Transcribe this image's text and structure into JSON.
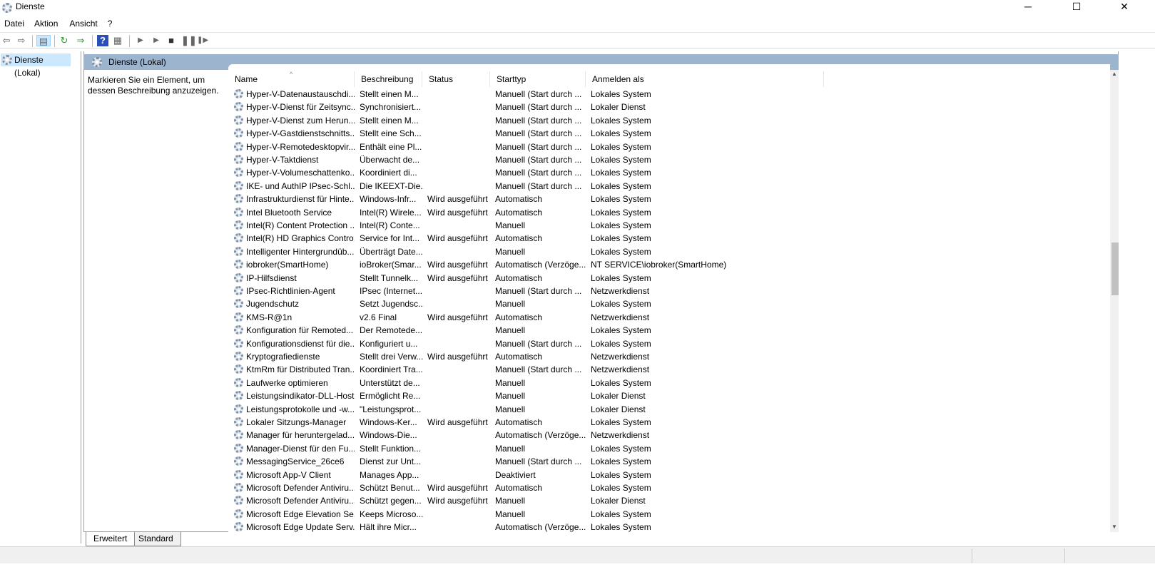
{
  "window": {
    "title": "Dienste",
    "minimize": "─",
    "maximize": "☐",
    "close": "✕"
  },
  "menu": [
    "Datei",
    "Aktion",
    "Ansicht",
    "?"
  ],
  "toolbar": {
    "icons": [
      "back-icon",
      "forward-icon",
      "show-hide-console-tree-icon",
      "refresh-icon",
      "export-list-icon",
      "help-icon",
      "properties-icon",
      "start-icon",
      "start-alt-icon",
      "stop-icon",
      "pause-icon",
      "restart-icon"
    ]
  },
  "tree": {
    "item": "Dienste (Lokal)"
  },
  "main": {
    "header": "Dienste (Lokal)",
    "description": "Markieren Sie ein Element, um dessen Beschreibung anzuzeigen.",
    "columns": [
      "Name",
      "Beschreibung",
      "Status",
      "Starttyp",
      "Anmelden als"
    ],
    "rows": [
      [
        "Hyper-V-Datenaustauschdi...",
        "Stellt einen M...",
        "",
        "Manuell (Start durch ...",
        "Lokales System"
      ],
      [
        "Hyper-V-Dienst für Zeitsync...",
        "Synchronisiert...",
        "",
        "Manuell (Start durch ...",
        "Lokaler Dienst"
      ],
      [
        "Hyper-V-Dienst zum Herun...",
        "Stellt einen M...",
        "",
        "Manuell (Start durch ...",
        "Lokales System"
      ],
      [
        "Hyper-V-Gastdienstschnitts...",
        "Stellt eine Sch...",
        "",
        "Manuell (Start durch ...",
        "Lokales System"
      ],
      [
        "Hyper-V-Remotedesktopvir...",
        "Enthält eine Pl...",
        "",
        "Manuell (Start durch ...",
        "Lokales System"
      ],
      [
        "Hyper-V-Taktdienst",
        "Überwacht de...",
        "",
        "Manuell (Start durch ...",
        "Lokales System"
      ],
      [
        "Hyper-V-Volumeschattenko...",
        "Koordiniert di...",
        "",
        "Manuell (Start durch ...",
        "Lokales System"
      ],
      [
        "IKE- und AuthIP IPsec-Schl...",
        "Die IKEEXT-Die...",
        "",
        "Manuell (Start durch ...",
        "Lokales System"
      ],
      [
        "Infrastrukturdienst für Hinte...",
        "Windows-Infr...",
        "Wird ausgeführt",
        "Automatisch",
        "Lokales System"
      ],
      [
        "Intel Bluetooth Service",
        "Intel(R) Wirele...",
        "Wird ausgeführt",
        "Automatisch",
        "Lokales System"
      ],
      [
        "Intel(R) Content Protection ...",
        "Intel(R) Conte...",
        "",
        "Manuell",
        "Lokales System"
      ],
      [
        "Intel(R) HD Graphics Contro...",
        "Service for Int...",
        "Wird ausgeführt",
        "Automatisch",
        "Lokales System"
      ],
      [
        "Intelligenter Hintergrundüb...",
        "Überträgt Date...",
        "",
        "Manuell",
        "Lokales System"
      ],
      [
        "iobroker(SmartHome)",
        "ioBroker(Smar...",
        "Wird ausgeführt",
        "Automatisch (Verzöge...",
        "NT SERVICE\\iobroker(SmartHome)"
      ],
      [
        "IP-Hilfsdienst",
        "Stellt Tunnelk...",
        "Wird ausgeführt",
        "Automatisch",
        "Lokales System"
      ],
      [
        "IPsec-Richtlinien-Agent",
        "IPsec (Internet...",
        "",
        "Manuell (Start durch ...",
        "Netzwerkdienst"
      ],
      [
        "Jugendschutz",
        "Setzt Jugendsc...",
        "",
        "Manuell",
        "Lokales System"
      ],
      [
        "KMS-R@1n",
        "v2.6 Final",
        "Wird ausgeführt",
        "Automatisch",
        "Netzwerkdienst"
      ],
      [
        "Konfiguration für Remoted...",
        "Der Remotede...",
        "",
        "Manuell",
        "Lokales System"
      ],
      [
        "Konfigurationsdienst für die...",
        "Konfiguriert u...",
        "",
        "Manuell (Start durch ...",
        "Lokales System"
      ],
      [
        "Kryptografiedienste",
        "Stellt drei Verw...",
        "Wird ausgeführt",
        "Automatisch",
        "Netzwerkdienst"
      ],
      [
        "KtmRm für Distributed Tran...",
        "Koordiniert Tra...",
        "",
        "Manuell (Start durch ...",
        "Netzwerkdienst"
      ],
      [
        "Laufwerke optimieren",
        "Unterstützt de...",
        "",
        "Manuell",
        "Lokales System"
      ],
      [
        "Leistungsindikator-DLL-Host",
        "Ermöglicht Re...",
        "",
        "Manuell",
        "Lokaler Dienst"
      ],
      [
        "Leistungsprotokolle und -w...",
        "\"Leistungsprot...",
        "",
        "Manuell",
        "Lokaler Dienst"
      ],
      [
        "Lokaler Sitzungs-Manager",
        "Windows-Ker...",
        "Wird ausgeführt",
        "Automatisch",
        "Lokales System"
      ],
      [
        "Manager für heruntergelad...",
        "Windows-Die...",
        "",
        "Automatisch (Verzöge...",
        "Netzwerkdienst"
      ],
      [
        "Manager-Dienst für den Fu...",
        "Stellt Funktion...",
        "",
        "Manuell",
        "Lokales System"
      ],
      [
        "MessagingService_26ce6",
        "Dienst zur Unt...",
        "",
        "Manuell (Start durch ...",
        "Lokales System"
      ],
      [
        "Microsoft App-V Client",
        "Manages App...",
        "",
        "Deaktiviert",
        "Lokales System"
      ],
      [
        "Microsoft Defender Antiviru...",
        "Schützt Benut...",
        "Wird ausgeführt",
        "Automatisch",
        "Lokales System"
      ],
      [
        "Microsoft Defender Antiviru...",
        "Schützt gegen...",
        "Wird ausgeführt",
        "Manuell",
        "Lokaler Dienst"
      ],
      [
        "Microsoft Edge Elevation Se...",
        "Keeps Microso...",
        "",
        "Manuell",
        "Lokales System"
      ],
      [
        "Microsoft Edge Update Serv...",
        "Hält ihre Micr...",
        "",
        "Automatisch (Verzöge...",
        "Lokales System"
      ]
    ]
  },
  "tabs": [
    "Erweitert",
    "Standard"
  ]
}
